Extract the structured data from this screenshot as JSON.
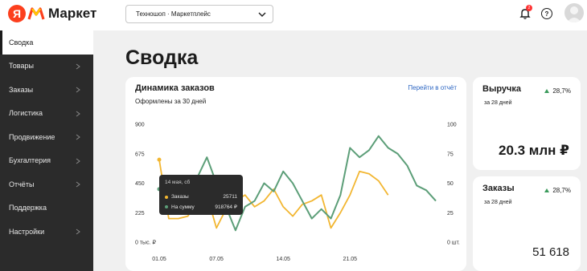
{
  "header": {
    "logo_letter": "Я",
    "logo_text": "Маркет",
    "shop_select": "Техношоп · Маркетплейс",
    "notifications_count": "2",
    "help_label": "?"
  },
  "sidebar": {
    "items": [
      {
        "label": "Сводка"
      },
      {
        "label": "Товары"
      },
      {
        "label": "Заказы"
      },
      {
        "label": "Логистика"
      },
      {
        "label": "Продвижение"
      },
      {
        "label": "Бухгалтерия"
      },
      {
        "label": "Отчёты"
      },
      {
        "label": "Поддержка"
      },
      {
        "label": "Настройки"
      }
    ]
  },
  "page": {
    "title": "Сводка"
  },
  "orders_card": {
    "title": "Динамика заказов",
    "subtitle": "Оформлены за 30 дней",
    "link": "Перейти в отчёт"
  },
  "tooltip": {
    "date": "14 мая, сб",
    "orders_label": "Заказы",
    "orders_value": "25711",
    "sum_label": "На сумму",
    "sum_value": "918764 ₽"
  },
  "kpi": {
    "revenue": {
      "title": "Выручка",
      "subtitle": "за 28 дней",
      "trend": "28,7%",
      "value": "20.3 млн ₽"
    },
    "orders": {
      "title": "Заказы",
      "subtitle": "за 28 дней",
      "trend": "28,7%",
      "value": "51 618"
    }
  },
  "colors": {
    "green_series": "#5c9e78",
    "yellow_series": "#f2b631",
    "trend_up": "#3a9a5b",
    "link": "#2b65c2"
  },
  "chart_data": {
    "type": "line",
    "left_axis_ticks": [
      "900",
      "675",
      "450",
      "225",
      "0 тыс. ₽"
    ],
    "left_axis_values": [
      900,
      675,
      450,
      225,
      0
    ],
    "right_axis_ticks": [
      "100",
      "75",
      "50",
      "25",
      "0 шт."
    ],
    "right_axis_values": [
      100,
      75,
      50,
      25,
      0
    ],
    "x_ticks": [
      "01.05",
      "07.05",
      "14.05",
      "21.05"
    ],
    "x_tick_index": [
      0,
      6,
      13,
      20
    ],
    "series": [
      {
        "axis": "right",
        "values": [
          70,
          20,
          20,
          22,
          35,
          40,
          12,
          28,
          35,
          40,
          30,
          35,
          45,
          30,
          22,
          32,
          35,
          40,
          12,
          25,
          40,
          60,
          58,
          52,
          40
        ]
      },
      {
        "axis": "right",
        "values": [
          45,
          27,
          28,
          35,
          55,
          72,
          50,
          30,
          10,
          30,
          35,
          50,
          43,
          60,
          50,
          35,
          20,
          28,
          20,
          40,
          80,
          72,
          78,
          90,
          80,
          75,
          65,
          48,
          44,
          35
        ]
      }
    ],
    "ylim_left": [
      0,
      900
    ],
    "ylim_right": [
      0,
      100
    ],
    "grid": false
  }
}
